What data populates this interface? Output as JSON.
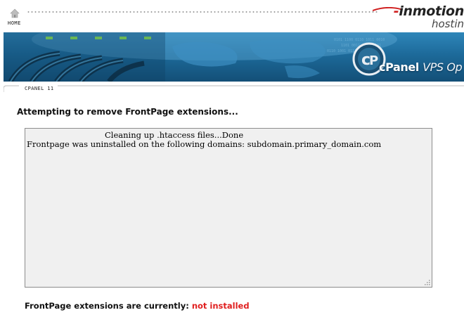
{
  "topbar": {
    "home_label": "HOME",
    "home_icon": "home-icon",
    "brand_name": "inmotion",
    "brand_sub": "hostin"
  },
  "banner": {
    "cpanel_word": "cPanel",
    "vps_word": "VPS Op"
  },
  "tab": {
    "label": "CPANEL 11"
  },
  "main": {
    "heading": "Attempting to remove FrontPage extensions...",
    "output_line1": "Cleaning up .htaccess files...Done",
    "output_line2_prefix": "Frontpage was uninstalled on the following domains:",
    "output_line2_domain": "subdomain.primary_domain.com",
    "status_label": "FrontPage extensions are currently:",
    "status_value": "not installed"
  },
  "colors": {
    "status_value": "#e02020",
    "banner_blue": "#1d6a9a",
    "output_bg": "#f0f0f0"
  }
}
